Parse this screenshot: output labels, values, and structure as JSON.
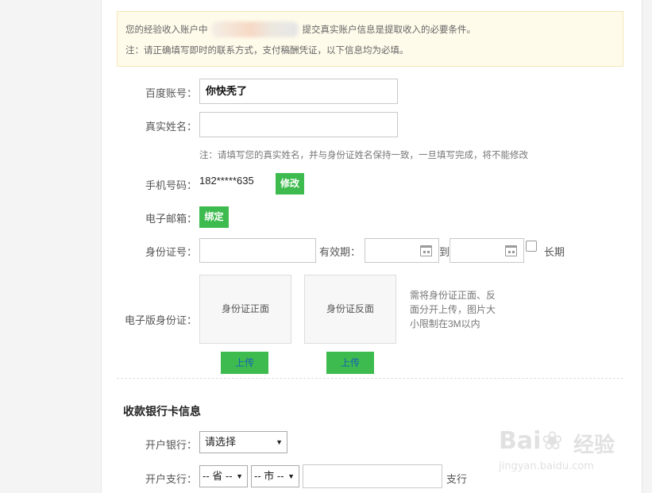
{
  "notice": {
    "line1_prefix": "您的经验收入账户中",
    "line1_suffix": "提交真实账户信息是提取收入的必要条件。",
    "line2": "注：请正确填写即时的联系方式，支付稿酬凭证，以下信息均为必填。"
  },
  "account": {
    "baidu_label": "百度账号：",
    "baidu_value": "你快秃了",
    "realname_label": "真实姓名：",
    "realname_value": "",
    "realname_hint": "注：请填写您的真实姓名，并与身份证姓名保持一致，一旦填写完成，将不能修改",
    "phone_label": "手机号码：",
    "phone_value": "182*****635",
    "phone_modify": "修改",
    "email_label": "电子邮箱：",
    "email_bind": "绑定",
    "id_label": "身份证号：",
    "id_value": "",
    "validity_label": "有效期：",
    "to_label": "到",
    "longterm_label": "长期",
    "eid_label": "电子版身份证：",
    "id_front": "身份证正面",
    "id_back": "身份证反面",
    "upload_label": "上传",
    "id_hint_1": "需将身份证正面、反",
    "id_hint_2": "面分开上传，图片大",
    "id_hint_3": "小限制在3M以内"
  },
  "bank": {
    "section_title": "收款银行卡信息",
    "bank_label": "开户银行：",
    "bank_select": "请选择",
    "branch_label": "开户支行：",
    "province_select": "-- 省 --",
    "city_select": "-- 市 --",
    "branch_value": "",
    "branch_suffix": "支行"
  },
  "watermark": {
    "brand_left": "Bai",
    "brand_right": "经验",
    "url": "jingyan.baidu.com"
  },
  "colors": {
    "accent_green": "#3dbb4e",
    "notice_bg": "#fffbeb"
  }
}
